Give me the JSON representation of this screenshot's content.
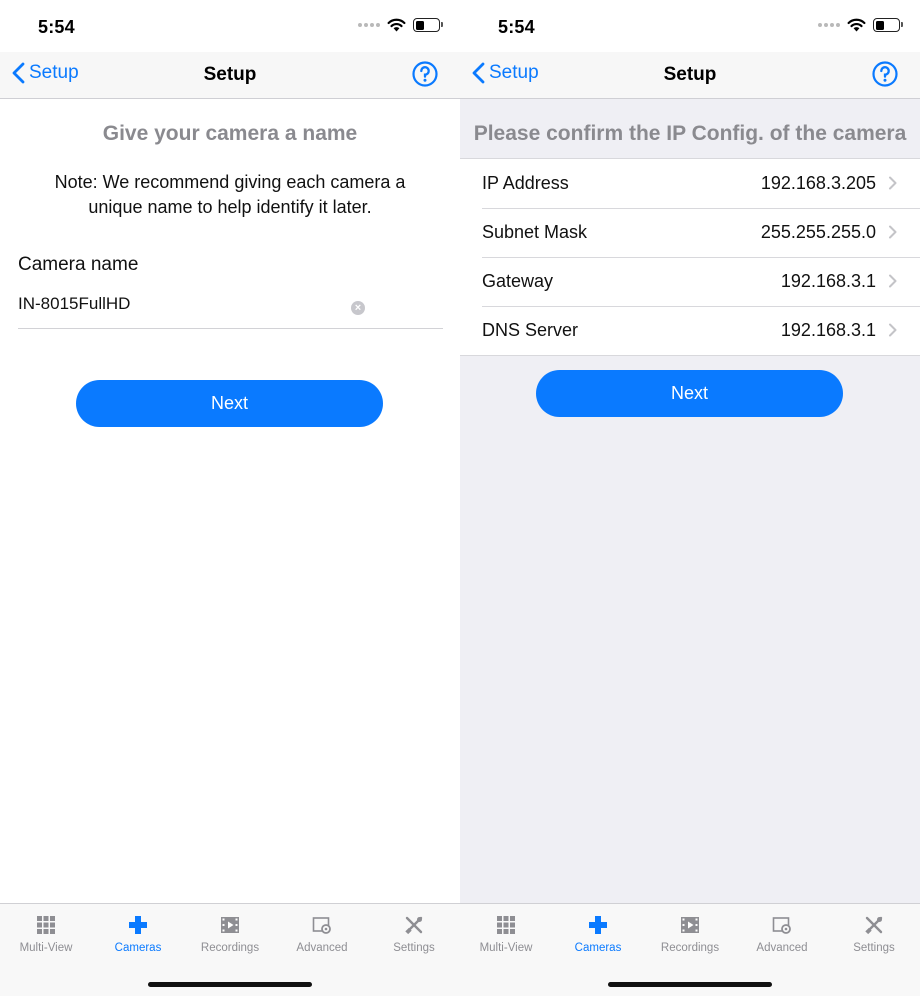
{
  "screens": [
    {
      "status": {
        "time": "5:54"
      },
      "nav": {
        "back_label": "Setup",
        "title": "Setup"
      },
      "heading": "Give your camera a name",
      "note": "Note: We recommend giving each camera a unique name to help identify it later.",
      "camera_name": {
        "label": "Camera name",
        "value": "IN-8015FullHD"
      },
      "next_label": "Next"
    },
    {
      "status": {
        "time": "5:54"
      },
      "nav": {
        "back_label": "Setup",
        "title": "Setup"
      },
      "heading": "Please confirm the IP Config. of the camera",
      "rows": [
        {
          "label": "IP Address",
          "value": "192.168.3.205"
        },
        {
          "label": "Subnet Mask",
          "value": "255.255.255.0"
        },
        {
          "label": "Gateway",
          "value": "192.168.3.1"
        },
        {
          "label": "DNS Server",
          "value": "192.168.3.1"
        }
      ],
      "next_label": "Next"
    }
  ],
  "tabbar": {
    "items": [
      {
        "label": "Multi-View",
        "icon": "grid-icon"
      },
      {
        "label": "Cameras",
        "icon": "plus-icon",
        "active": true
      },
      {
        "label": "Recordings",
        "icon": "film-icon"
      },
      {
        "label": "Advanced",
        "icon": "advanced-gear-icon"
      },
      {
        "label": "Settings",
        "icon": "tools-icon"
      }
    ]
  },
  "colors": {
    "accent": "#0a7aff",
    "muted_heading": "#8a8a8f",
    "tab_inactive": "#8e8e93",
    "grouped_bg": "#efeff4"
  }
}
